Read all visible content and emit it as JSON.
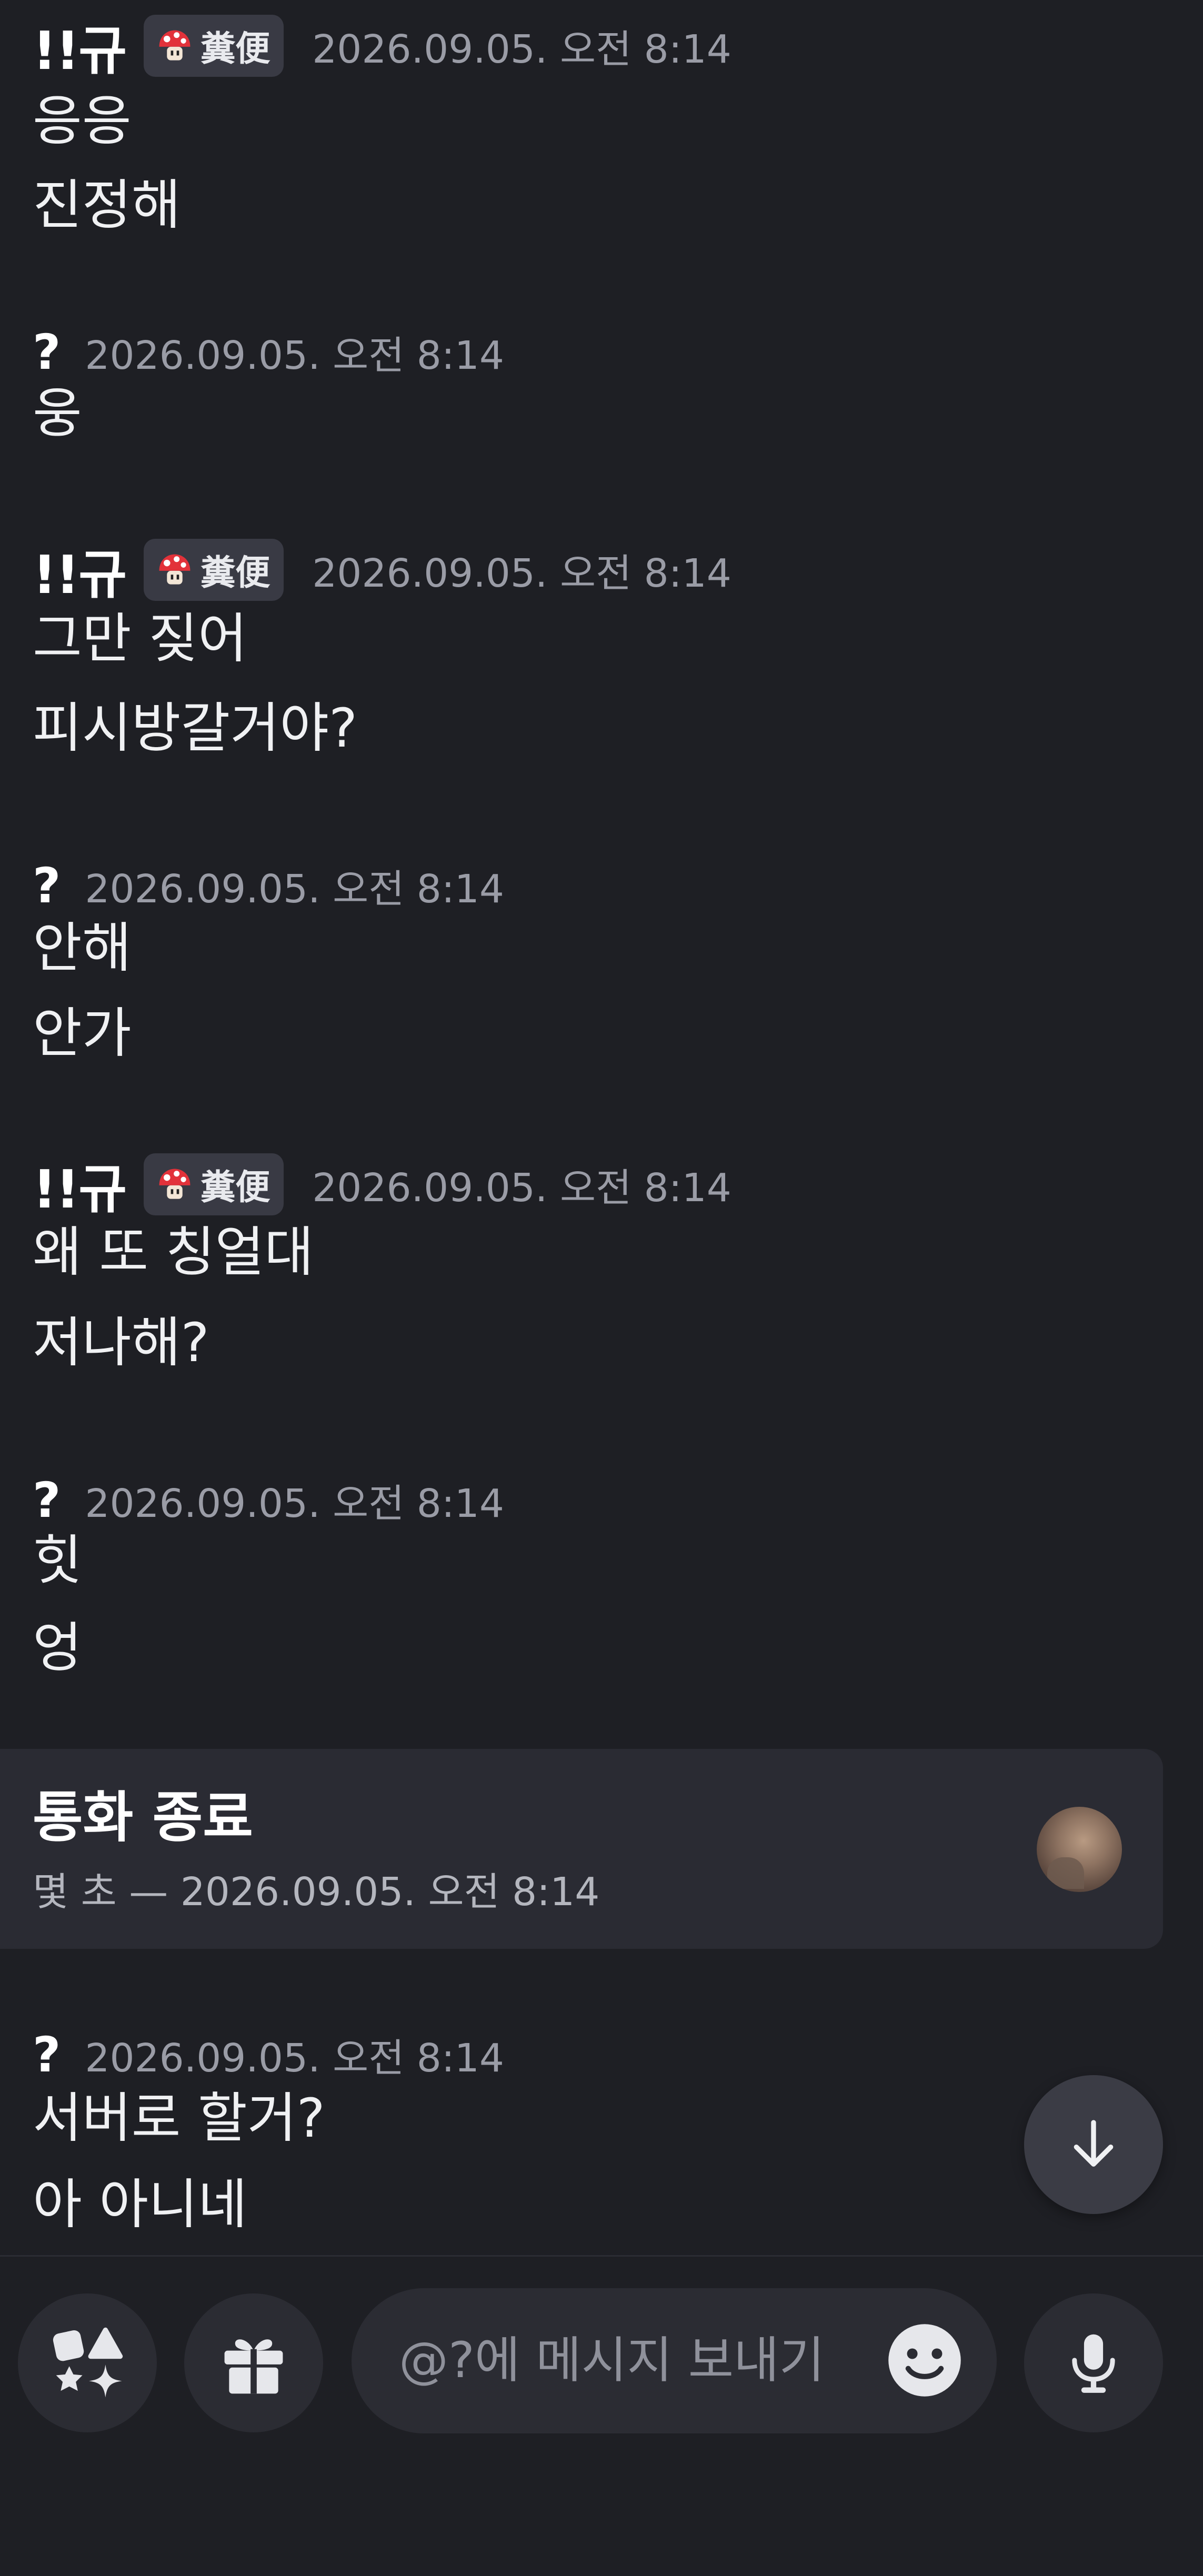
{
  "messages": [
    {
      "author": "!!규",
      "tag": "糞便",
      "time": "2026.09.05. 오전 8:14",
      "lines": [
        "응응",
        "진정해"
      ]
    },
    {
      "author": "?",
      "time": "2026.09.05. 오전 8:14",
      "lines": [
        "웅"
      ]
    },
    {
      "author": "!!규",
      "tag": "糞便",
      "time": "2026.09.05. 오전 8:14",
      "lines": [
        "그만 짖어",
        "피시방갈거야?"
      ]
    },
    {
      "author": "?",
      "time": "2026.09.05. 오전 8:14",
      "lines": [
        "안해",
        "안가"
      ]
    },
    {
      "author": "!!규",
      "tag": "糞便",
      "time": "2026.09.05. 오전 8:14",
      "lines": [
        "왜 또 칭얼대",
        "저나해?"
      ]
    },
    {
      "author": "?",
      "time": "2026.09.05. 오전 8:14",
      "lines": [
        "힛",
        "엉"
      ]
    },
    {
      "author": "?",
      "time": "2026.09.05. 오전 8:14",
      "lines": [
        "서버로 할거?",
        "아 아니네"
      ]
    }
  ],
  "call": {
    "title": "통화 종료",
    "subtitle": "몇 초 — 2026.09.05. 오전 8:14"
  },
  "composer": {
    "placeholder": "@?에 메시지 보내기",
    "icons": {
      "apps": "apps-icon",
      "gift": "gift-icon",
      "emoji": "emoji-icon",
      "mic": "microphone-icon",
      "scroll": "arrow-down-icon"
    }
  },
  "colors": {
    "background": "#1e1f24",
    "surface": "#2b2c33",
    "card": "#2a2b33",
    "tag_background": "#393a44",
    "text": "#f0f1f3",
    "muted": "#9a9ca6"
  }
}
